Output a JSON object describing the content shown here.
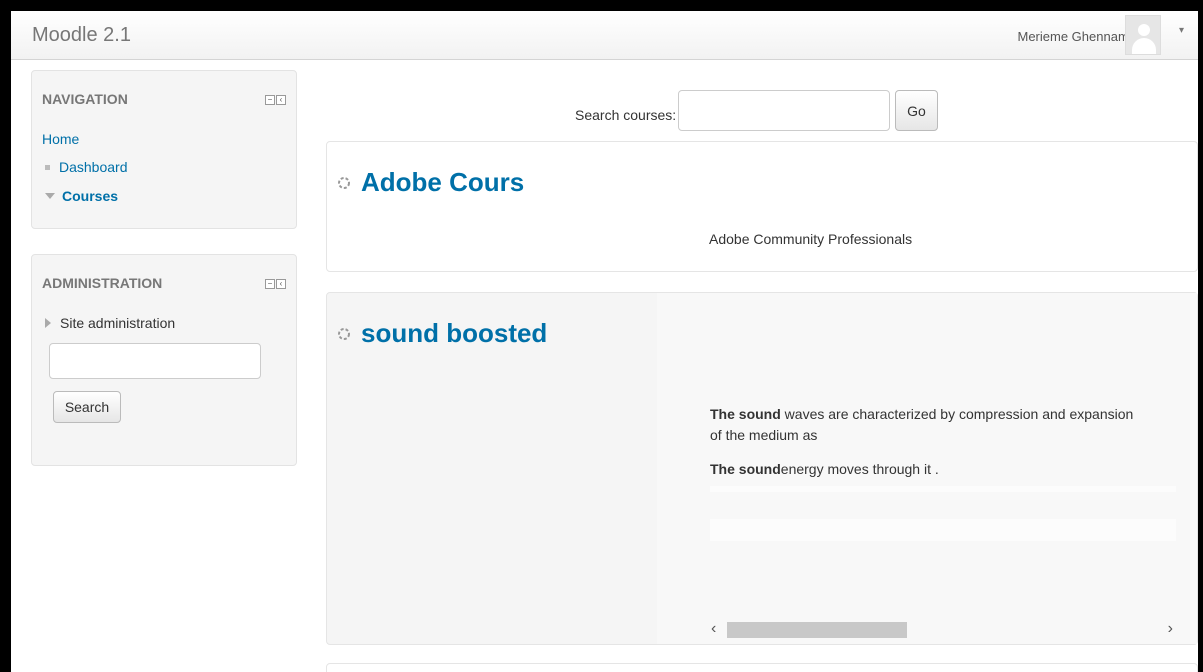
{
  "navbar": {
    "brand": "Moodle 2.1",
    "user_name": "Merieme Ghenname",
    "user_caret": "▾"
  },
  "navigation": {
    "title": "NAVIGATION",
    "home": "Home",
    "items": [
      {
        "label": "Dashboard",
        "icon": "bullet-icon"
      },
      {
        "label": "Courses",
        "icon": "expanded-arrow-icon"
      }
    ]
  },
  "administration": {
    "title": "ADMINISTRATION",
    "site_admin": "Site administration",
    "search_value": "",
    "search_button": "Search"
  },
  "course_search": {
    "label": "Search courses:",
    "value": "",
    "button": "Go"
  },
  "courses": [
    {
      "title": "Adobe Cours",
      "summary": "Adobe Community Professionals"
    },
    {
      "title": "sound boosted",
      "summary_lines": [
        {
          "bold": "The sound",
          "rest": " waves are characterized by compression and expansion"
        },
        {
          "bold": "",
          "rest": "of the medium as"
        },
        {
          "bold": "The sound",
          "rest": "energy moves through it ."
        }
      ]
    }
  ],
  "scrollbar": {
    "left_arrow": "‹",
    "right_arrow": "›"
  },
  "colors": {
    "link": "#0070a8",
    "block_bg": "#f5f5f5"
  }
}
